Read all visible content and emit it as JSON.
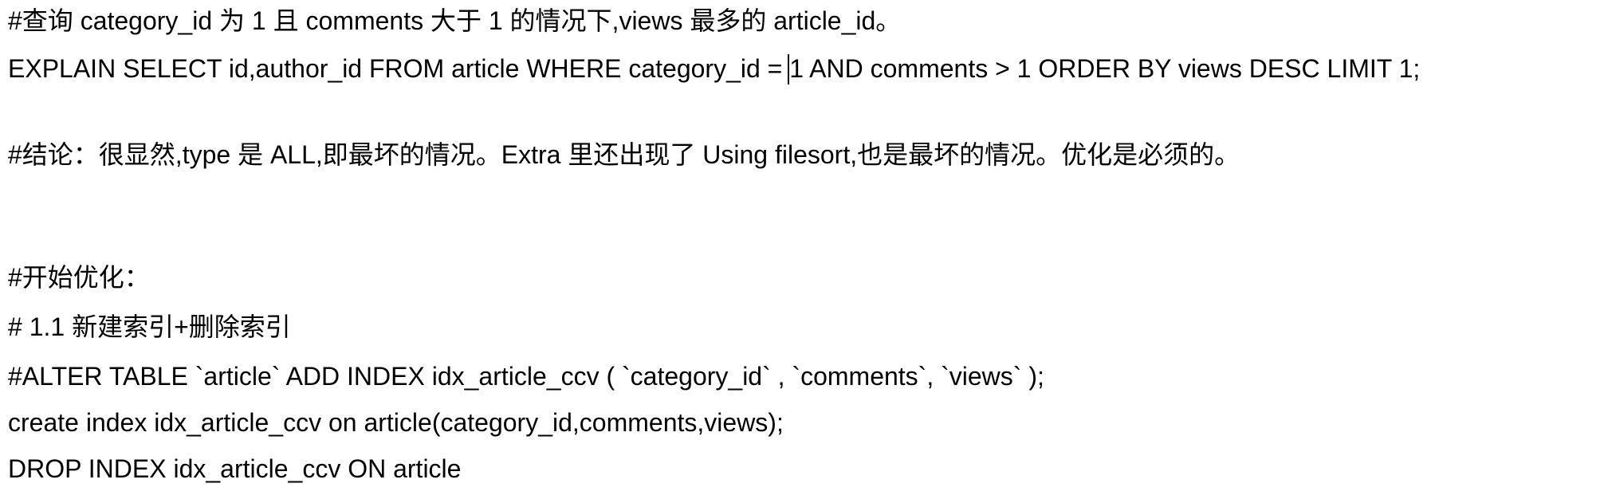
{
  "document": {
    "lines": [
      "#查询 category_id 为 1 且 comments 大于 1 的情况下,views 最多的 article_id。",
      "EXPLAIN SELECT id,author_id FROM article WHERE category_id = 1 AND comments > 1 ORDER BY views DESC LIMIT 1;",
      "#结论：很显然,type 是 ALL,即最坏的情况。Extra 里还出现了 Using filesort,也是最坏的情况。优化是必须的。",
      "#开始优化：",
      "# 1.1 新建索引+删除索引",
      "#ALTER TABLE `article` ADD INDEX idx_article_ccv ( `category_id` , `comments`, `views` );",
      "create index idx_article_ccv on article(category_id,comments,views);",
      "DROP INDEX idx_article_ccv ON article"
    ]
  }
}
